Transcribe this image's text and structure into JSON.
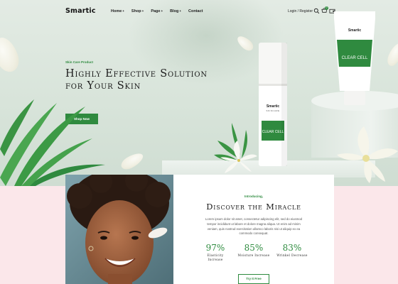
{
  "header": {
    "logo": "Smartic",
    "nav": [
      {
        "label": "Home",
        "chevron": "+"
      },
      {
        "label": "Shop",
        "chevron": "+"
      },
      {
        "label": "Page",
        "chevron": "+"
      },
      {
        "label": "Blog",
        "chevron": "+"
      },
      {
        "label": "Contact",
        "chevron": ""
      }
    ],
    "login": "Login / Register",
    "cart_count": "0",
    "icons": [
      "search-icon",
      "cart-icon",
      "wallet-icon"
    ]
  },
  "hero": {
    "eyebrow": "Skin Care Product",
    "headline": "Highly Effective Solution for Your Skin",
    "cta": "Shop Now",
    "pump_brand": "Smartic",
    "pump_sub": "SKINCARE",
    "pump_product": "CLEAR CELL",
    "tube_brand": "Smartic",
    "tube_product": "CLEAR CELL"
  },
  "section2": {
    "intro": "Introducing,",
    "title": "Discover the Miracle",
    "body": "Lorem ipsum dolor sit amet, consectetur adipiscing elit, sed do eiusmod tempor incididunt ut labore et dolore magna aliqua. Ut enim ad minim veniam, quis nostrud exercitation ullamco laboris nisi ut aliquip ex ea commodo consequat.",
    "stats": [
      {
        "value": "97%",
        "label": "Elasticity Increase"
      },
      {
        "value": "85%",
        "label": "Moisture Increase"
      },
      {
        "value": "83%",
        "label": "Wrinkel Decrease"
      }
    ],
    "cta": "Try It Free"
  },
  "colors": {
    "accent": "#2f8a3f",
    "hero_bg": "#dce6de",
    "pink": "#fbe7ea"
  }
}
